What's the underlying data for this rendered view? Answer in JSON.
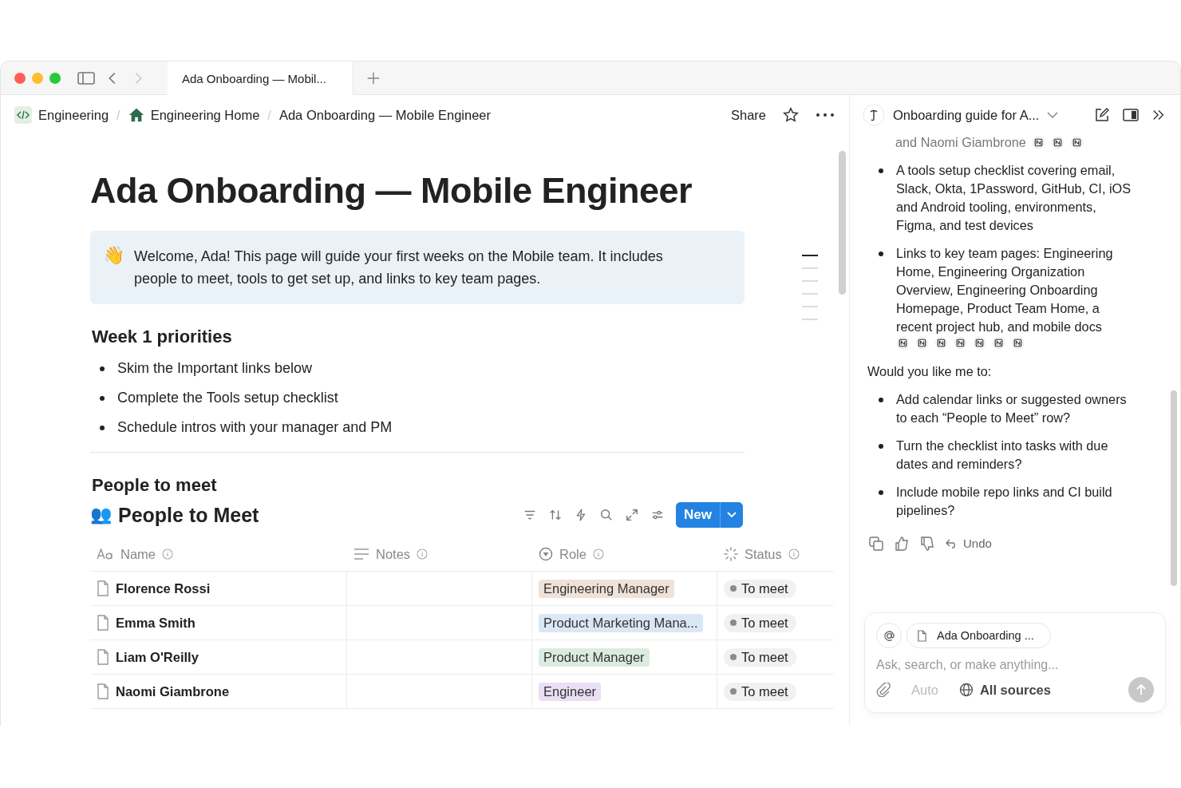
{
  "window": {
    "tab_title": "Ada Onboarding — Mobil...",
    "breadcrumbs": [
      {
        "label": "Engineering"
      },
      {
        "separator": "/",
        "label": "Engineering Home"
      },
      {
        "separator": "/",
        "label": "Ada Onboarding — Mobile Engineer"
      }
    ],
    "share": "Share"
  },
  "page": {
    "title": "Ada Onboarding — Mobile Engineer",
    "callout": {
      "emoji": "👋",
      "text": "Welcome, Ada! This page will guide your first weeks on the Mobile team. It includes people to meet, tools to get set up, and links to key team pages."
    },
    "week_heading": "Week 1 priorities",
    "priorities": [
      "Skim the Important links below",
      "Complete the Tools setup checklist",
      "Schedule intros with your manager and PM"
    ],
    "people_heading": "People to meet",
    "toc": [
      {
        "selected": true
      },
      {
        "selected": false
      },
      {
        "selected": false
      },
      {
        "selected": false
      },
      {
        "selected": false
      },
      {
        "selected": false
      }
    ],
    "database": {
      "emoji": "👥",
      "title": "People to Meet",
      "new_button": "New",
      "columns": [
        {
          "label": "Name",
          "kind": "title"
        },
        {
          "label": "Notes",
          "kind": "text"
        },
        {
          "label": "Role",
          "kind": "select"
        },
        {
          "label": "Status",
          "kind": "status"
        }
      ],
      "rows": [
        {
          "name": "Florence Rossi",
          "role": {
            "label": "Engineering Manager",
            "color": "#efe2d8"
          },
          "status": {
            "label": "To meet",
            "color": "#8a8a8a"
          }
        },
        {
          "name": "Emma Smith",
          "role": {
            "label": "Product Marketing Mana...",
            "color": "#dbe7f4"
          },
          "status": {
            "label": "To meet",
            "color": "#8a8a8a"
          }
        },
        {
          "name": "Liam O'Reilly",
          "role": {
            "label": "Product Manager",
            "color": "#dcebe0"
          },
          "status": {
            "label": "To meet",
            "color": "#8a8a8a"
          }
        },
        {
          "name": "Naomi Giambrone",
          "role": {
            "label": "Engineer",
            "color": "#eadff4"
          },
          "status": {
            "label": "To meet",
            "color": "#8a8a8a"
          }
        }
      ]
    }
  },
  "assistant": {
    "title": "Onboarding guide for A...",
    "partial_line": {
      "text": "and Naomi Giambrone",
      "citations": [
        {
          "kind": "page"
        },
        {
          "kind": "page"
        },
        {
          "kind": "page"
        }
      ]
    },
    "bullets": [
      {
        "text": "A tools setup checklist covering email, Slack, Okta, 1Password, GitHub, CI, iOS and Android tooling, environments, Figma, and test devices"
      },
      {
        "text": "Links to key team pages: Engineering Home, Engineering Organization Overview, Engineering Onboarding Homepage, Product Team Home, a recent project hub, and mobile docs",
        "citations": [
          {
            "kind": "page"
          },
          {
            "kind": "page"
          },
          {
            "kind": "page"
          },
          {
            "kind": "page"
          },
          {
            "kind": "page"
          },
          {
            "kind": "page"
          },
          {
            "kind": "page"
          }
        ]
      }
    ],
    "question": "Would you like me to:",
    "options": [
      "Add calendar links or suggested owners to each “People to Meet” row?",
      "Turn the checklist into tasks with due dates and reminders?",
      "Include mobile repo links and CI build pipelines?"
    ],
    "undo": "Undo",
    "composer": {
      "context_chip": "Ada Onboarding ...",
      "placeholder": "Ask, search, or make anything...",
      "mode": "Auto",
      "sources": "All sources"
    }
  }
}
